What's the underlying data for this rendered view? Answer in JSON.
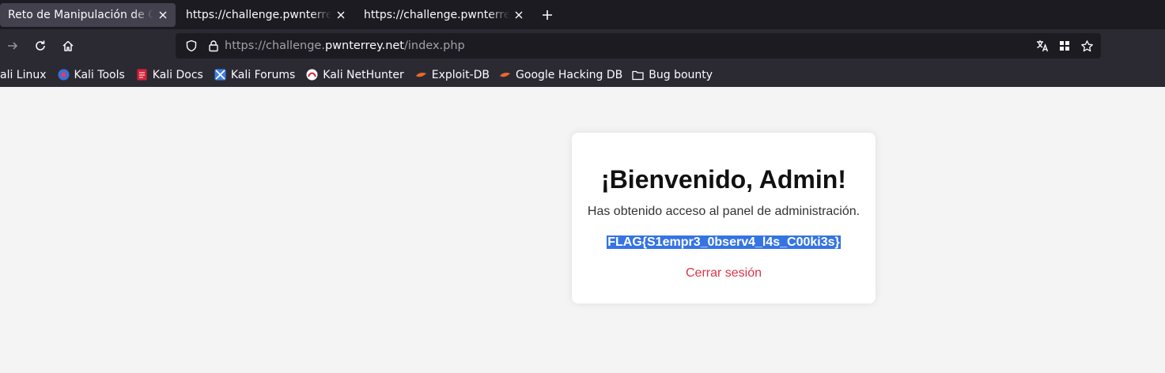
{
  "browser": {
    "tabs": [
      {
        "title": "Reto de Manipulación de Cookies",
        "active": true
      },
      {
        "title": "https://challenge.pwnterrey.net/",
        "active": false
      },
      {
        "title": "https://challenge.pwnterrey.net/",
        "active": false
      }
    ],
    "url": {
      "prefix": "https://challenge.",
      "host": "pwnterrey.net",
      "path": "/index.php"
    },
    "bookmarks": [
      {
        "label": "ali Linux",
        "icon": "kali-dragon-icon"
      },
      {
        "label": "Kali Tools",
        "icon": "kali-tools-icon"
      },
      {
        "label": "Kali Docs",
        "icon": "kali-docs-icon"
      },
      {
        "label": "Kali Forums",
        "icon": "kali-forums-icon"
      },
      {
        "label": "Kali NetHunter",
        "icon": "kali-nethunter-icon"
      },
      {
        "label": "Exploit-DB",
        "icon": "exploit-db-icon"
      },
      {
        "label": "Google Hacking DB",
        "icon": "exploit-db-icon"
      },
      {
        "label": "Bug bounty",
        "icon": "folder-icon"
      }
    ]
  },
  "page": {
    "heading": "¡Bienvenido, Admin!",
    "subtitle": "Has obtenido acceso al panel de administración.",
    "flag": "FLAG{S1empr3_0bserv4_l4s_C00ki3s}",
    "logout_label": "Cerrar sesión"
  },
  "colors": {
    "tab_strip": "#1c1b22",
    "toolbar": "#2b2a33",
    "page_bg": "#f4f4f4",
    "card_bg": "#ffffff",
    "selection": "#3574e3",
    "logout": "#dc3545"
  }
}
